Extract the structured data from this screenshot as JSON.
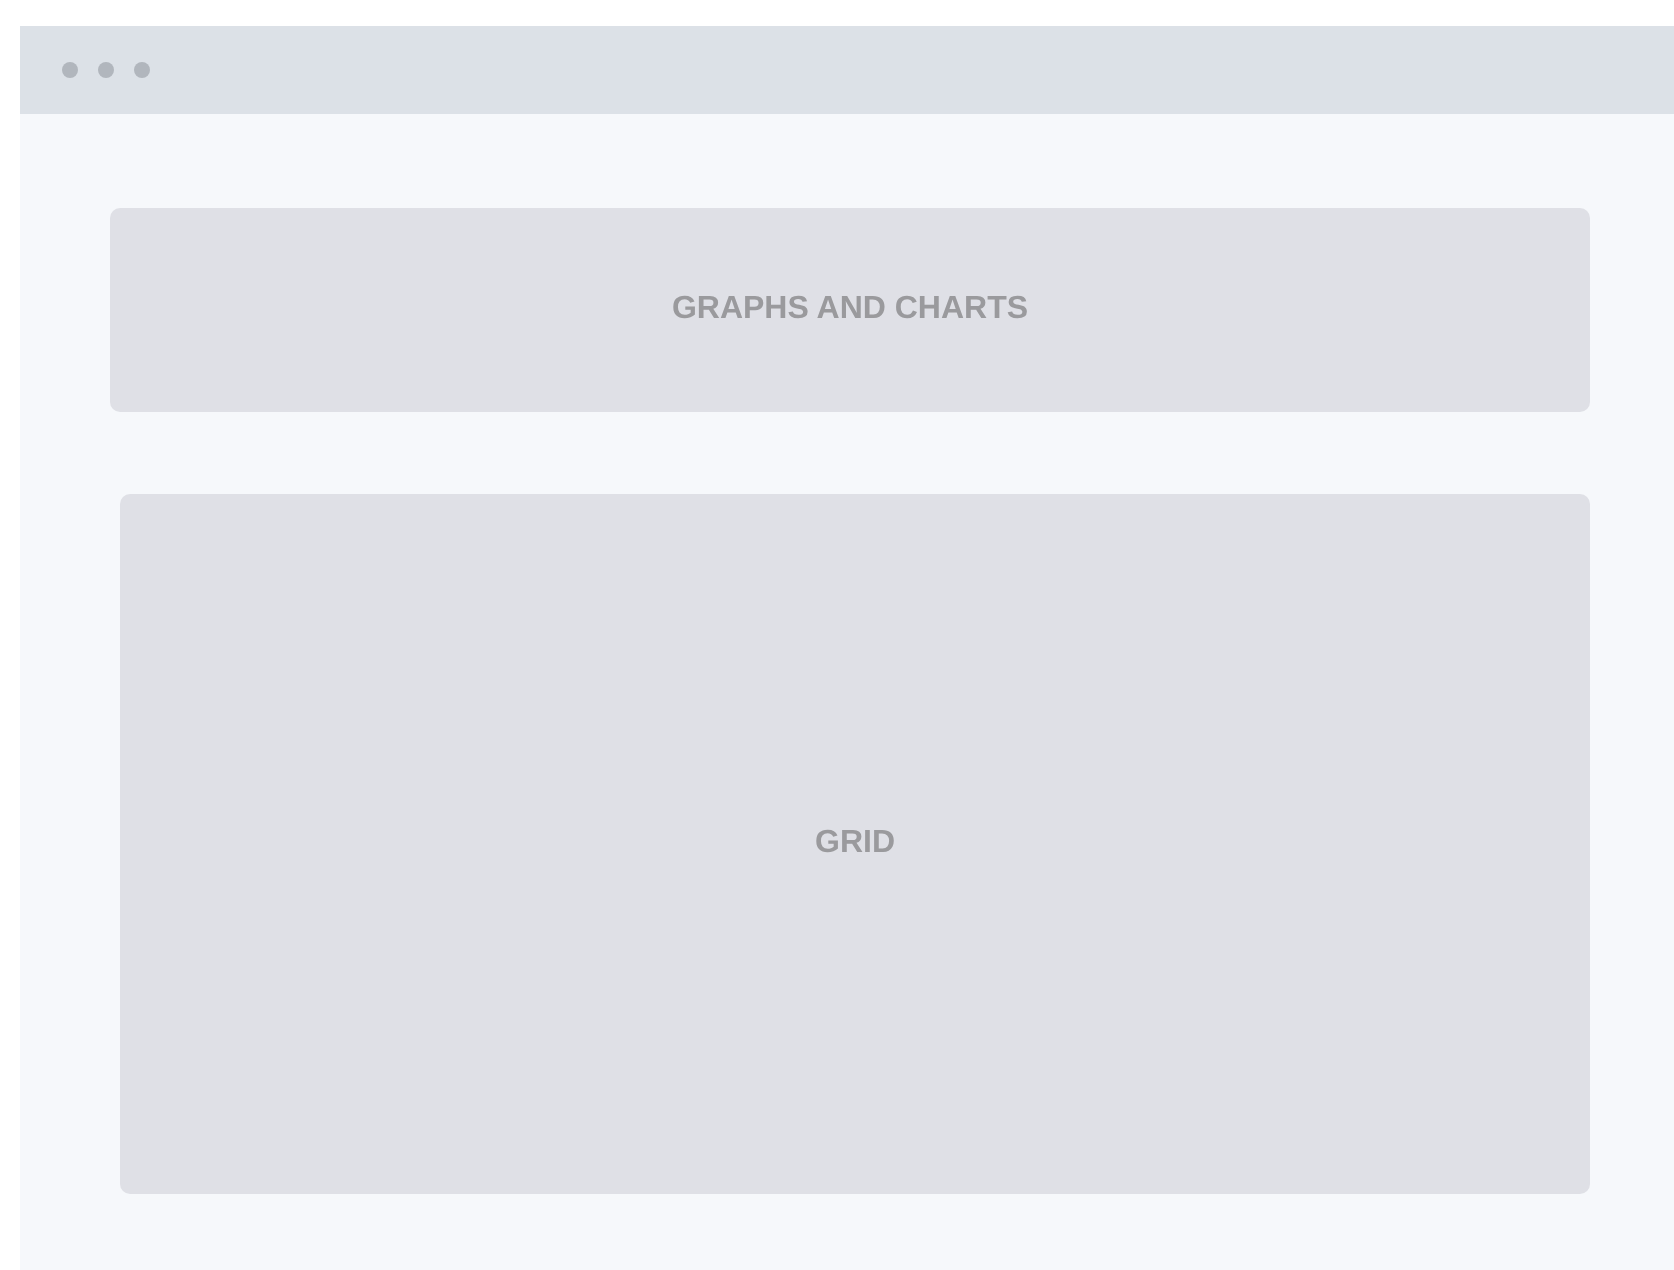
{
  "panels": [
    {
      "label": "GRAPHS AND CHARTS"
    },
    {
      "label": "GRID"
    }
  ]
}
